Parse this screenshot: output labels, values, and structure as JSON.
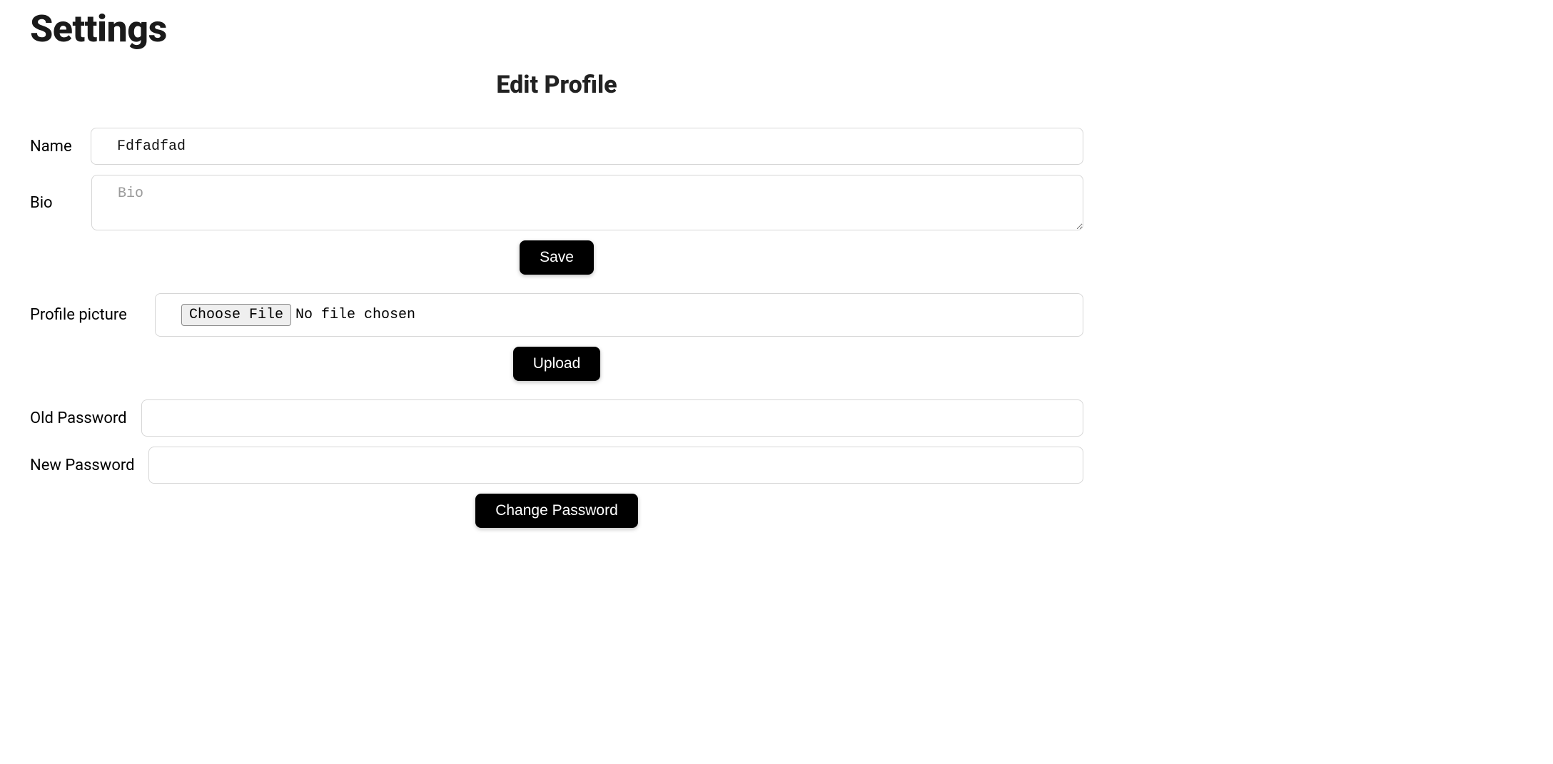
{
  "page": {
    "title": "Settings"
  },
  "profile": {
    "heading": "Edit Profile",
    "name": {
      "label": "Name",
      "value": "Fdfadfad"
    },
    "bio": {
      "label": "Bio",
      "placeholder": "Bio",
      "value": ""
    },
    "save_label": "Save",
    "picture": {
      "label": "Profile picture",
      "choose_label": "Choose File",
      "status": "No file chosen"
    },
    "upload_label": "Upload",
    "old_password": {
      "label": "Old Password",
      "value": ""
    },
    "new_password": {
      "label": "New Password",
      "value": ""
    },
    "change_password_label": "Change Password"
  }
}
